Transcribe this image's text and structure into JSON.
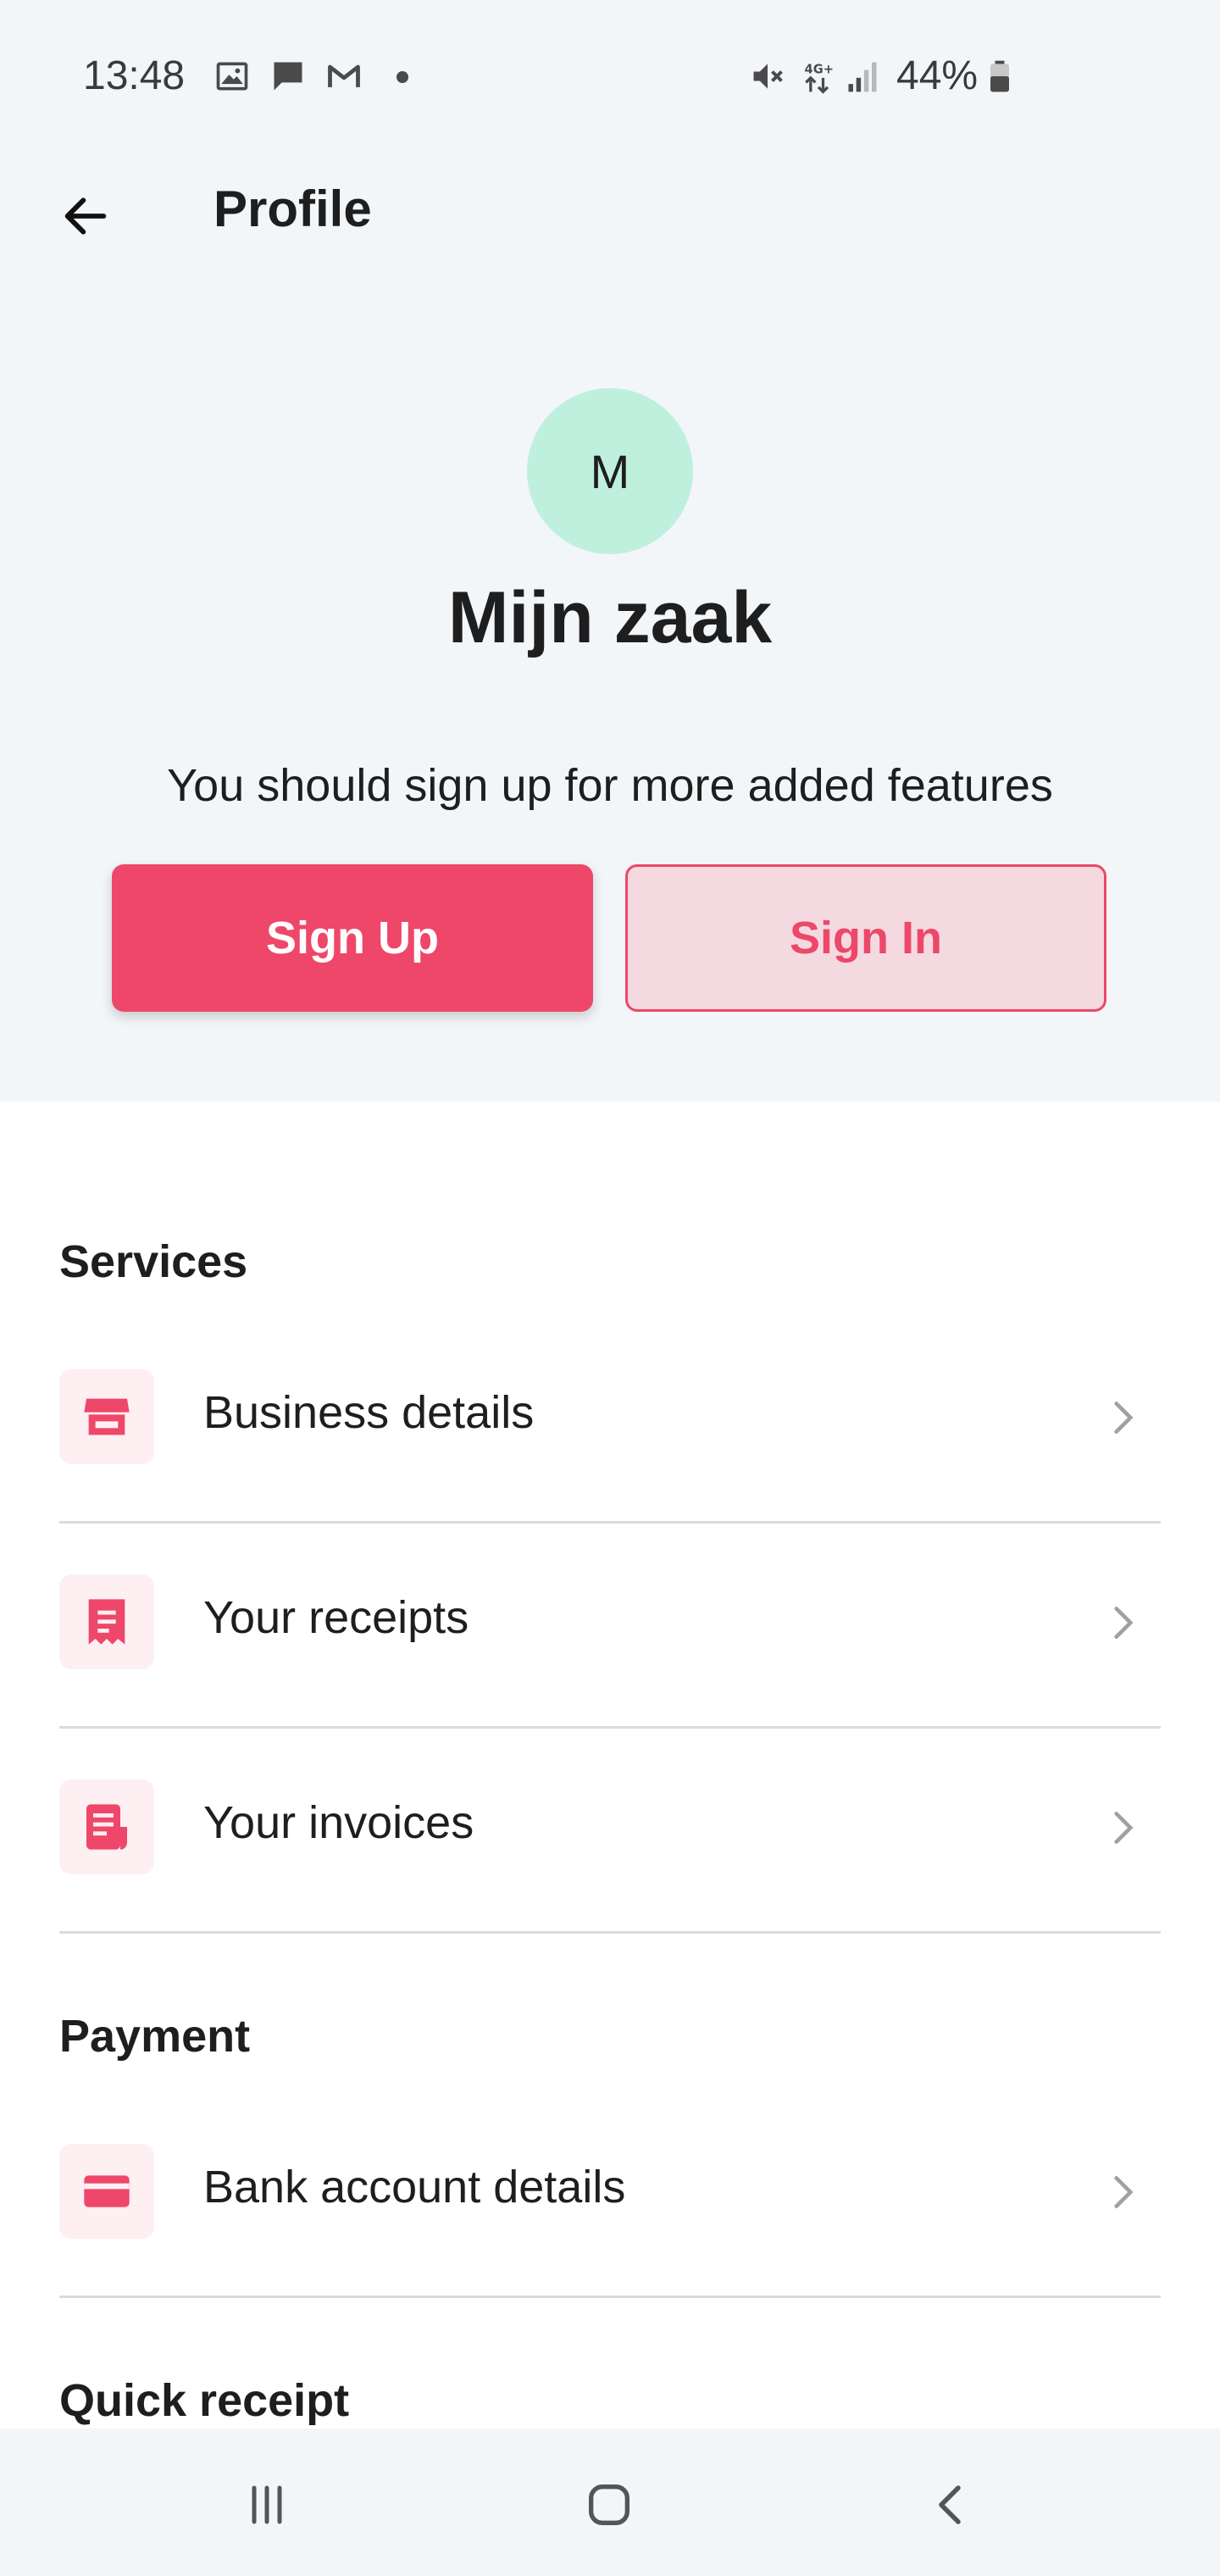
{
  "status_bar": {
    "time": "13:48",
    "battery": "44%",
    "icons": [
      "gallery-icon",
      "message-icon",
      "gmail-icon",
      "dot-icon",
      "mute-icon",
      "network-4g-icon",
      "signal-icon",
      "battery-icon"
    ]
  },
  "app_bar": {
    "title": "Profile",
    "back_icon": "arrow-left-icon"
  },
  "profile": {
    "avatar_initial": "M",
    "business_name": "Mijn zaak",
    "hint": "You should sign up for more added features",
    "signup_label": "Sign Up",
    "signin_label": "Sign In"
  },
  "sections": {
    "services": {
      "title": "Services",
      "items": [
        {
          "label": "Business details",
          "icon": "store-icon"
        },
        {
          "label": "Your receipts",
          "icon": "receipt-icon"
        },
        {
          "label": "Your invoices",
          "icon": "invoice-icon"
        }
      ]
    },
    "payment": {
      "title": "Payment",
      "items": [
        {
          "label": "Bank account details",
          "icon": "credit-card-icon"
        }
      ]
    },
    "quick_receipt": {
      "title": "Quick receipt"
    }
  },
  "nav_bar": {
    "buttons": [
      "recents-icon",
      "home-icon",
      "back-icon"
    ]
  },
  "colors": {
    "accent": "#ef4769",
    "accent_light": "#f5d9e1",
    "avatar_bg": "#bff0de",
    "header_bg": "#f3f6f9"
  }
}
